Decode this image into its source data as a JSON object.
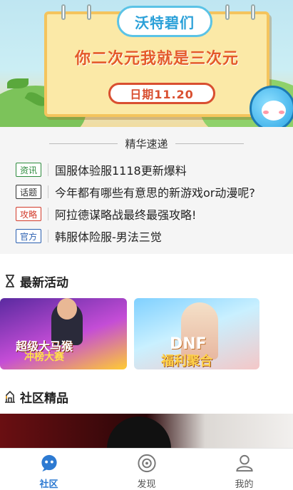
{
  "banner": {
    "logo_text": "沃特碧们",
    "title": "你二次元我就是三次元",
    "date": "日期11.20"
  },
  "digest": {
    "heading": "精华速递",
    "items": [
      {
        "tag": "资讯",
        "tag_color": "#2e8b3e",
        "text": "国服体验服1118更新爆料"
      },
      {
        "tag": "话题",
        "tag_color": "#333333",
        "text": "今年都有哪些有意思的新游戏or动漫呢?"
      },
      {
        "tag": "攻略",
        "tag_color": "#d23a2a",
        "text": "阿拉德谋略战最终最强攻略!"
      },
      {
        "tag": "官方",
        "tag_color": "#2a5fb0",
        "text": "韩服体险服-男法三觉"
      }
    ]
  },
  "sections": {
    "activities": "最新活动",
    "community": "社区精品"
  },
  "activities": [
    {
      "line1": "超级大马猴",
      "line2": "冲榜大赛"
    },
    {
      "line1": "DNF",
      "line2": "福利聚合"
    }
  ],
  "tabbar": {
    "items": [
      {
        "label": "社区",
        "icon": "community-icon",
        "active": true
      },
      {
        "label": "发现",
        "icon": "discover-icon",
        "active": false
      },
      {
        "label": "我的",
        "icon": "profile-icon",
        "active": false
      }
    ],
    "active_color": "#2d7ad2"
  }
}
